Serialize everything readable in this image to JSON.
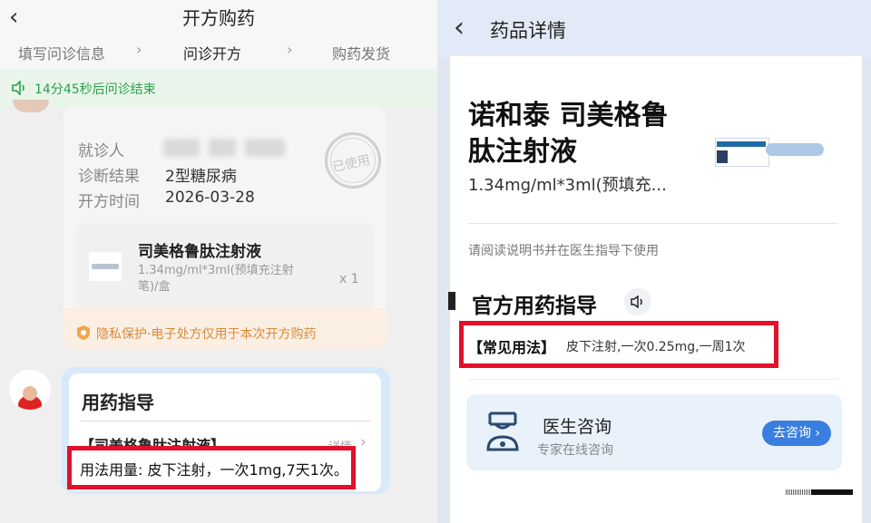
{
  "left": {
    "header": {
      "back_glyph": "‹",
      "title": "开方购药"
    },
    "steps": [
      "填写问诊信息",
      "问诊开方",
      "购药发货"
    ],
    "timer": {
      "text": "14分45秒后问诊结束"
    },
    "prescription": {
      "patient_label": "就诊人",
      "diagnosis_label": "诊断结果",
      "diagnosis_value": "2型糖尿病",
      "date_label": "开方时间",
      "date_value": "2026-03-28",
      "stamp_text": "已使用",
      "drug": {
        "name": "司美格鲁肽注射液",
        "spec": "1.34mg/ml*3ml(预填充注射笔)/盒",
        "qty": "x 1"
      },
      "privacy_text": "隐私保护·电子处方仅用于本次开方购药"
    },
    "guidance": {
      "title": "用药指导",
      "drug_line": "【司美格鲁肽注射液】",
      "details_link": "详情",
      "usage": "用法用量: 皮下注射，一次1mg,7天1次。"
    }
  },
  "right": {
    "header": {
      "back_glyph": "‹",
      "title": "药品详情"
    },
    "product": {
      "name_line1": "诺和泰 司美格鲁",
      "name_line2": "肽注射液",
      "spec": "1.34mg/ml*3ml(预填充...",
      "notice": "请阅读说明书并在医生指导下使用"
    },
    "official": {
      "title": "官方用药指导",
      "usage_tag": "【常见用法】",
      "usage_text": "皮下注射,一次0.25mg,一周1次"
    },
    "doctor": {
      "title": "医生咨询",
      "subtitle": "专家在线咨询",
      "button": "去咨询 ›"
    }
  },
  "colors": {
    "accent_green": "#2aa14a",
    "highlight_red": "#e2102a",
    "button_blue": "#3a7ee0",
    "privacy_orange": "#d98a3a"
  }
}
